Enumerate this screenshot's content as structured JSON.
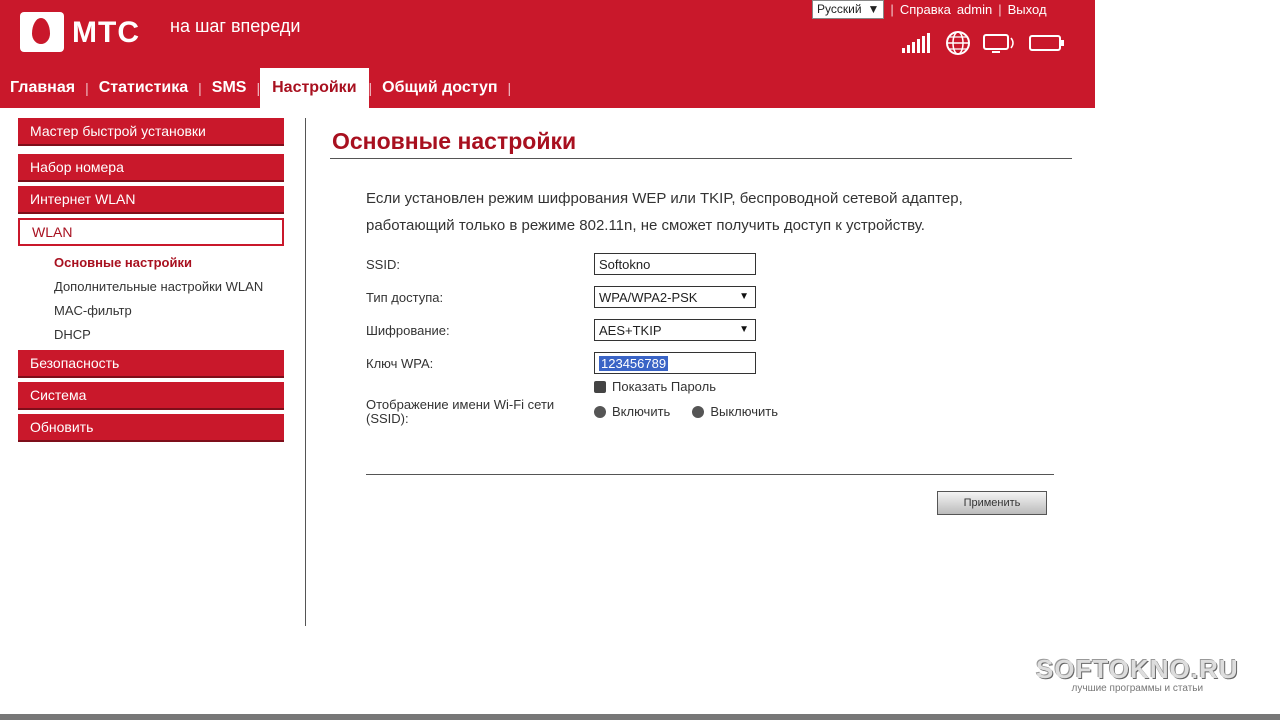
{
  "header": {
    "brand": "МТС",
    "slogan": "на шаг впереди",
    "language": "Русский",
    "links": {
      "help": "Справка",
      "user": "admin",
      "logout": "Выход"
    },
    "status_icons": [
      "signal-icon",
      "globe-icon",
      "connection-icon",
      "battery-icon"
    ]
  },
  "tabs": [
    {
      "label": "Главная"
    },
    {
      "label": "Статистика"
    },
    {
      "label": "SMS"
    },
    {
      "label": "Настройки",
      "active": true
    },
    {
      "label": "Общий доступ"
    }
  ],
  "sidebar": {
    "quick_setup": "Мастер быстрой установки",
    "dialing": "Набор номера",
    "internet_wlan": "Интернет WLAN",
    "wlan": "WLAN",
    "sub": [
      "Основные настройки",
      "Дополнительные настройки WLAN",
      "MAC-фильтр",
      "DHCP"
    ],
    "security": "Безопасность",
    "system": "Система",
    "update": "Обновить"
  },
  "main": {
    "title": "Основные настройки",
    "info_line1": "Если установлен режим шифрования WEP или TKIP, беспроводной сетевой адаптер,",
    "info_line2": "работающий только в режиме 802.11n, не сможет получить доступ к устройству.",
    "ssid_label": "SSID:",
    "ssid_value": "Softokno",
    "access_label": "Тип доступа:",
    "access_value": "WPA/WPA2-PSK",
    "encryption_label": "Шифрование:",
    "encryption_value": "AES+TKIP",
    "wpa_label": "Ключ WPA:",
    "wpa_value": "123456789",
    "show_password": "Показать Пароль",
    "broadcast_label": "Отображение имени Wi-Fi сети (SSID):",
    "radio_on": "Включить",
    "radio_off": "Выключить",
    "apply": "Применить"
  },
  "watermark": {
    "main": "SOFTOKNO.RU",
    "sub": "лучшие программы и статьи"
  },
  "colors": {
    "brand_red": "#c9182b",
    "dark_red": "#a8101f"
  }
}
